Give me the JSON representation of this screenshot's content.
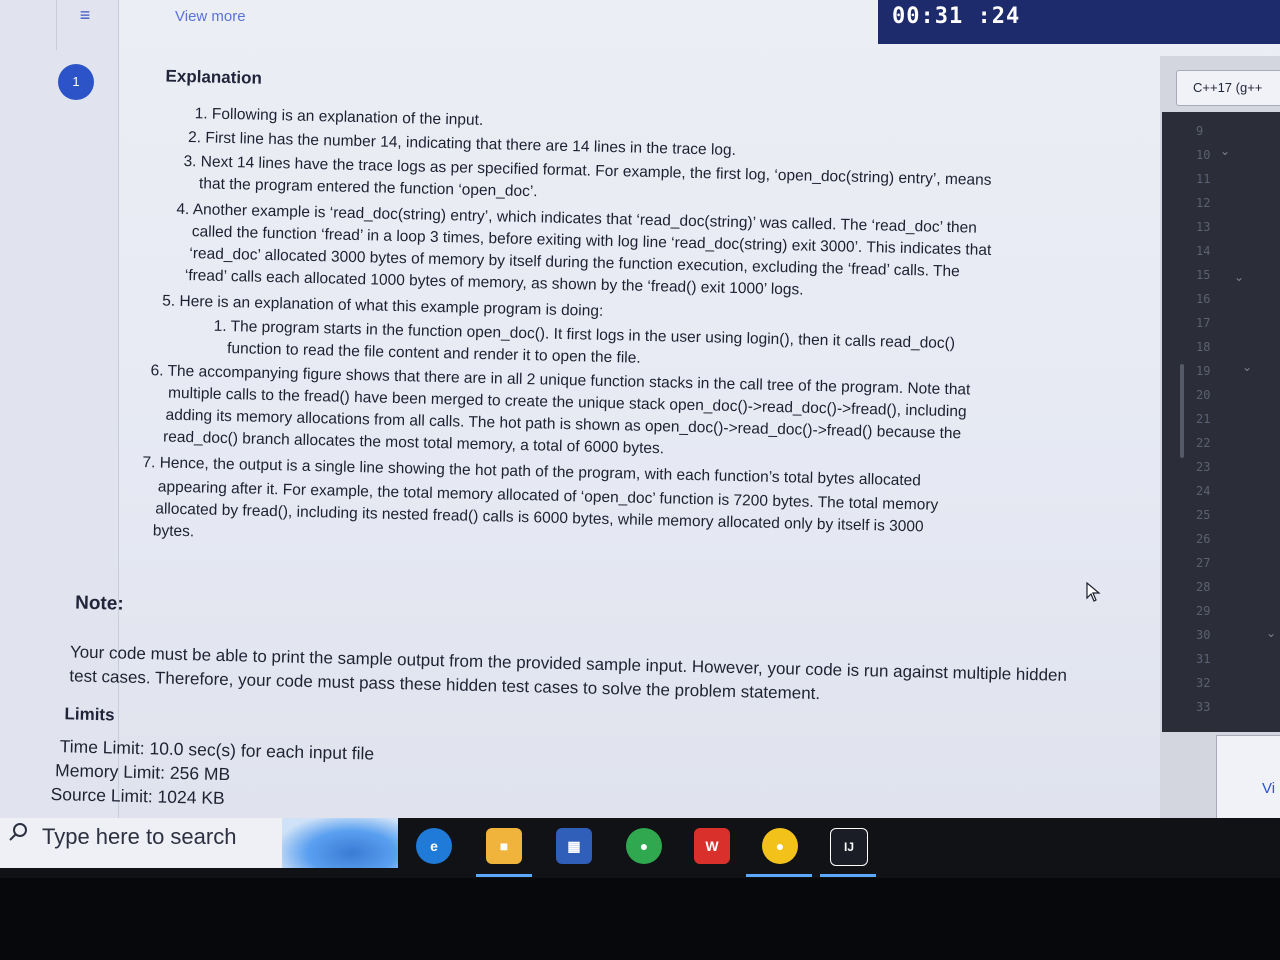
{
  "header": {
    "view_more": "View more",
    "timer": "00:31 :24"
  },
  "sidebar": {
    "question_badge": "1"
  },
  "problem": {
    "explanation_heading": "Explanation",
    "items": [
      "1. Following is an explanation of the input.",
      "2. First line has the number 14, indicating that there are 14 lines in the trace log.",
      "3. Next 14 lines have the trace logs as per specified format. For example, the first log, ‘open_doc(string) entry’, means",
      "that the program entered the function ‘open_doc’.",
      "4. Another example is ‘read_doc(string) entry’, which indicates that ‘read_doc(string)’ was called. The ‘read_doc’ then",
      "called the function ‘fread’ in a loop 3 times, before exiting with log line ‘read_doc(string) exit 3000’. This indicates that",
      "‘read_doc’ allocated 3000 bytes of memory by itself during the function execution, excluding the ‘fread’ calls. The",
      "‘fread’ calls each allocated 1000 bytes of memory, as shown by the ‘fread() exit 1000’ logs.",
      "5. Here is an explanation of what this example program is doing:",
      "1. The program starts in the function open_doc(). It first logs in the user using login(), then it calls read_doc()",
      "function to read the file content and render it to open the file.",
      "6. The accompanying figure shows that there are in all 2 unique function stacks in the call tree of the program. Note that",
      "multiple calls to the fread() have been merged to create the unique stack open_doc()->read_doc()->fread(), including",
      "adding its memory allocations from all calls. The hot path is shown as open_doc()->read_doc()->fread() because the",
      "read_doc() branch allocates the most total memory, a total of 6000 bytes.",
      "7. Hence, the output is a single line showing the hot path of the program, with each function’s total bytes allocated",
      "appearing after it. For example, the total memory allocated of ‘open_doc’ function is 7200 bytes. The total memory",
      "allocated by fread(), including its nested fread() calls is 6000 bytes, while memory allocated only by itself is 3000",
      "bytes."
    ],
    "note_heading": "Note:",
    "note_text": "Your code must be able to print the sample output from the provided sample input. However, your code is run against multiple hidden test cases. Therefore, your code must pass these hidden test cases to solve the problem statement.",
    "limits_heading": "Limits",
    "time_limit": "Time Limit: 10.0 sec(s) for each input file",
    "memory_limit": "Memory Limit: 256 MB",
    "source_limit": "Source Limit: 1024 KB"
  },
  "editor": {
    "language": "C++17 (g++",
    "line_numbers": [
      "9",
      "10",
      "11",
      "12",
      "13",
      "14",
      "15",
      "16",
      "17",
      "18",
      "19",
      "20",
      "21",
      "22",
      "23",
      "24",
      "25",
      "26",
      "27",
      "28",
      "29",
      "30",
      "31",
      "32",
      "33"
    ],
    "view_label": "Vi"
  },
  "taskbar": {
    "search_placeholder": "Type here to search",
    "apps": [
      "Edge",
      "File Explorer",
      "Calendar",
      "Chrome",
      "WPS Office",
      "Chrome",
      "IntelliJ IDEA"
    ]
  },
  "colors": {
    "accent": "#2c53c7",
    "timer_bg": "#1d2a6b"
  }
}
